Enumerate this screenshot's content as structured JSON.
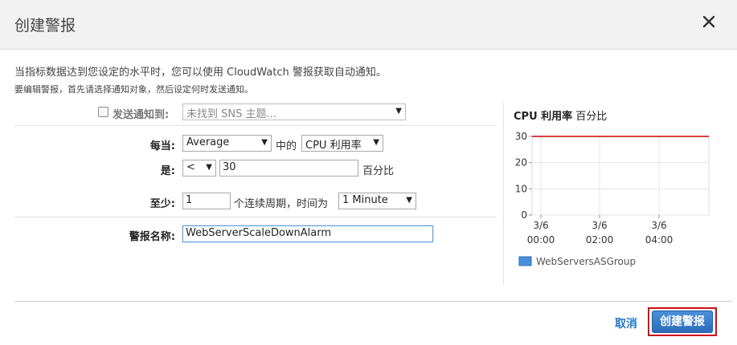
{
  "dialog": {
    "title": "创建警报",
    "intro": "当指标数据达到您设定的水平时，您可以使用 CloudWatch 警报获取自动通知。",
    "subintro": "要编辑警报，首先请选择通知对象，然后设定何时发送通知。"
  },
  "form": {
    "notify_label": "发送通知到:",
    "notify_select": "未找到 SNS 主题...",
    "notify_checked": false,
    "whenever_label": "每当:",
    "statistic_select": "Average",
    "of_text": "中的",
    "metric_select": "CPU 利用率",
    "is_label": "是:",
    "operator_select": "<",
    "threshold_value": "30",
    "unit_text": "百分比",
    "for_label": "至少:",
    "periods_value": "1",
    "periods_text": "个连续周期，时间为",
    "period_select": "1 Minute",
    "name_label": "警报名称:",
    "name_value": "WebServerScaleDownAlarm"
  },
  "chart_data": {
    "type": "line",
    "title": "CPU 利用率",
    "unit": "百分比",
    "ylim": [
      0,
      30
    ],
    "yticks": [
      "30",
      "20",
      "10",
      "0"
    ],
    "x_ticks": [
      {
        "date": "3/6",
        "time": "00:00"
      },
      {
        "date": "3/6",
        "time": "02:00"
      },
      {
        "date": "3/6",
        "time": "04:00"
      }
    ],
    "threshold": 30,
    "threshold_color": "#cc0000",
    "series": [
      {
        "name": "WebServersASGroup",
        "color": "#4a90d9",
        "values": []
      }
    ],
    "grid": true,
    "legend": "bottom-left"
  },
  "footer": {
    "cancel_label": "取消",
    "create_label": "创建警报"
  },
  "icons": {
    "close": "close-icon",
    "dropdown": "dropdown-arrow-icon"
  },
  "colors": {
    "primary_button": "#2a6ebb",
    "highlight_outline": "#cc1111",
    "link": "#2277cc"
  }
}
